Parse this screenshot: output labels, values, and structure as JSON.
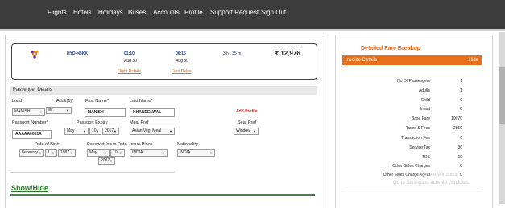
{
  "nav": {
    "items": [
      "Flights",
      "Hotels",
      "Holidays",
      "Buses",
      "Accounts",
      "Profile",
      "Support Request",
      "Sign Out"
    ]
  },
  "flight": {
    "route": "HYD->BKK",
    "depart_time": "01:10",
    "depart_date": "Aug 30",
    "arrive_time": "06:15",
    "arrive_date": "Aug 30",
    "duration": "3 h : 35 m",
    "price": "₹ 12,976",
    "flight_details_link": "Flight Details",
    "fare_rules_link": "Fare Rules"
  },
  "passenger": {
    "section_title": "Passenger Details",
    "load_label": "Load",
    "load_value": "MANISH .",
    "adults_label": "Adult(1)*",
    "title_value": "Mr",
    "first_name_label": "First Name*",
    "first_name_value": "MANISH",
    "last_name_label": "Last Name*",
    "last_name_value": "KHANDELWAL",
    "add_profile": "Add Profile",
    "passport_number_label": "Passport Number*",
    "passport_number_value": "AAAAA0001A",
    "passport_expiry_label": "Passport Expiry",
    "expiry_month": "May",
    "expiry_day": "10",
    "expiry_year": "2017",
    "meal_pref_label": "Meal Pref",
    "meal_pref_value": "Asian Veg. Meal",
    "seat_pref_label": "Seat Pref",
    "seat_pref_value": "Window",
    "dob_label": "Date of Birth",
    "dob_month": "February",
    "dob_day": "1",
    "dob_year": "1987",
    "issue_date_label": "Passport Issue Date",
    "issue_month": "May",
    "issue_day": "10",
    "issue_year": "2007",
    "issue_place_label": "Issue Place",
    "issue_place_value": "INDIA",
    "nationality_label": "Nationality",
    "nationality_value": "INDIA"
  },
  "show_hide": "Show/Hide",
  "fare": {
    "title": "Detailed Fare Breakup",
    "invoice_label": "Invoice Details",
    "hide_label": "Hide",
    "rows": [
      {
        "label": "No Of Passengers",
        "value": "1"
      },
      {
        "label": "Adults",
        "value": "1"
      },
      {
        "label": "Child",
        "value": "0"
      },
      {
        "label": "Infant",
        "value": "0"
      },
      {
        "label": "Base Fare",
        "value": "10070"
      },
      {
        "label": "Taxes & Fees",
        "value": "2859"
      },
      {
        "label": "Transaction Fee",
        "value": "0"
      },
      {
        "label": "Service Tax",
        "value": "36"
      },
      {
        "label": "TDS",
        "value": "10"
      },
      {
        "label": "Other Sales Charges",
        "value": "8"
      },
      {
        "label": "Other Sales Charge Agent",
        "value": "0"
      }
    ]
  },
  "watermark": {
    "line1": "Activate Windows",
    "line2": "Go to Settings to activate Windows."
  },
  "colors": {
    "nav_bg": "#3c3c3c",
    "accent_orange": "#e8701a",
    "link_blue": "#1a3a8a",
    "green": "#1f7a1f",
    "red": "#dd2222"
  }
}
